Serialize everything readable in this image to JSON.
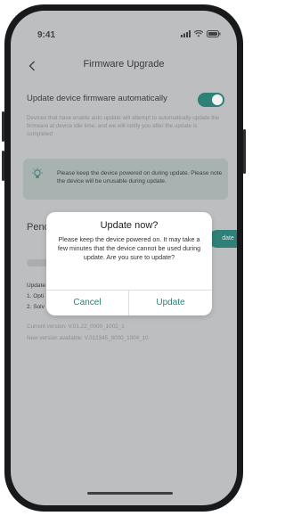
{
  "colors": {
    "accent": "#2e8078",
    "dim_background": "#bcbebf",
    "dialog_background": "#ffffff"
  },
  "status_bar": {
    "time": "9:41",
    "icons": [
      "signal-icon",
      "wifi-icon",
      "battery-icon"
    ]
  },
  "nav": {
    "back_icon": "chevron-left-icon",
    "title": "Firmware Upgrade"
  },
  "auto_update": {
    "label": "Update device firmware automatically",
    "enabled": true,
    "description": "Devices that have enable auto update will attempt to automatically update the firmware at device idle time, and we will notify you after the update is completed"
  },
  "notice": {
    "icon": "lightbulb-icon",
    "text": "Please keep the device powered on during update. Please note the device will be unusable during update."
  },
  "pending": {
    "title": "Pend",
    "update_button": "date"
  },
  "changelog": {
    "heading": "Update",
    "items": [
      "1. Opti",
      "2. Solv"
    ]
  },
  "versions": {
    "current": "Current version: V.01.22_0000_1002_1",
    "available": "New version available: V.012345_0000_1004_10"
  },
  "dialog": {
    "title": "Update now?",
    "message": "Please keep the device powered on. It may take a few minutes that the device cannot be used during update. Are you sure to update?",
    "cancel_label": "Cancel",
    "confirm_label": "Update"
  }
}
